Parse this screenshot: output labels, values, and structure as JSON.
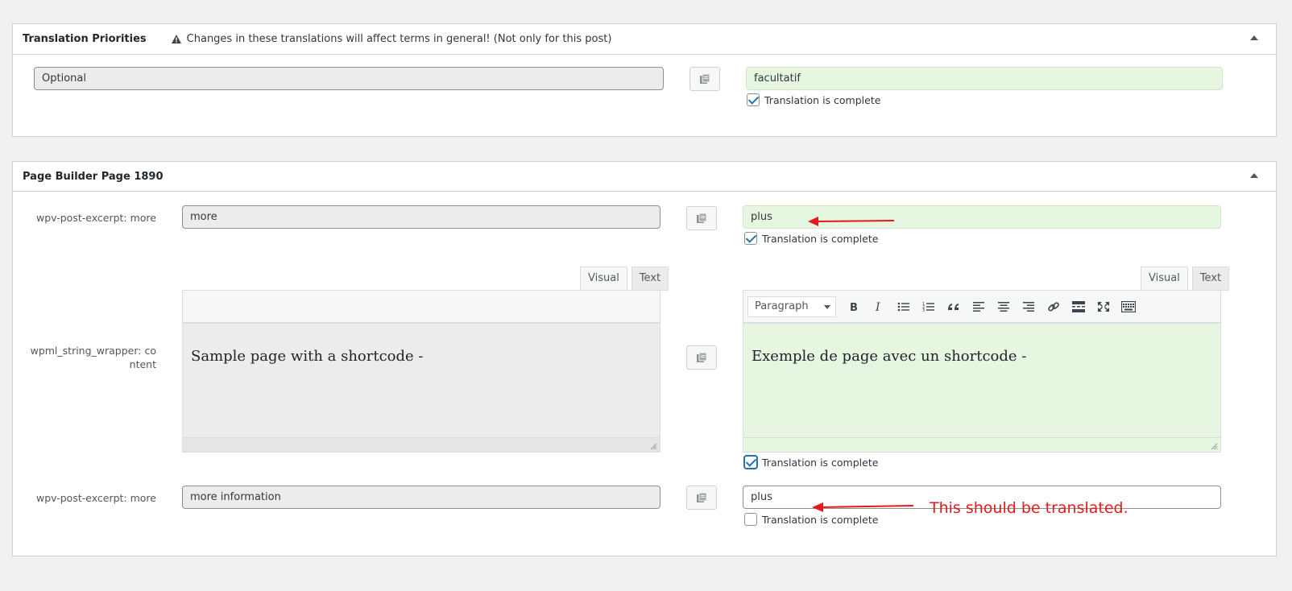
{
  "priorities": {
    "title": "Translation Priorities",
    "warning": "Changes in these translations will affect terms in general! (Not only for this post)",
    "source": "Optional",
    "translation": "facultatif",
    "complete_label": "Translation is complete"
  },
  "builder": {
    "title": "Page Builder Page 1890",
    "rows": [
      {
        "label": "wpv-post-excerpt: more",
        "source": "more",
        "translation": "plus",
        "complete_label": "Translation is complete",
        "complete": true
      },
      {
        "label_line1": "wpml_string_wrapper: co",
        "label_line2": "ntent",
        "tab_visual": "Visual",
        "tab_text": "Text",
        "format": "Paragraph",
        "source": "Sample page with a shortcode -",
        "translation": "Exemple de page avec un shortcode -",
        "complete_label": "Translation is complete",
        "complete": true
      },
      {
        "label": "wpv-post-excerpt: more",
        "source": "more information",
        "translation": "plus",
        "complete_label": "Translation is complete",
        "complete": false
      }
    ]
  },
  "annotation": {
    "text": "This should be translated.",
    "color": "#e51b1b"
  },
  "colors": {
    "complete_green": "#e6f6e1",
    "accent": "#2271b1"
  }
}
